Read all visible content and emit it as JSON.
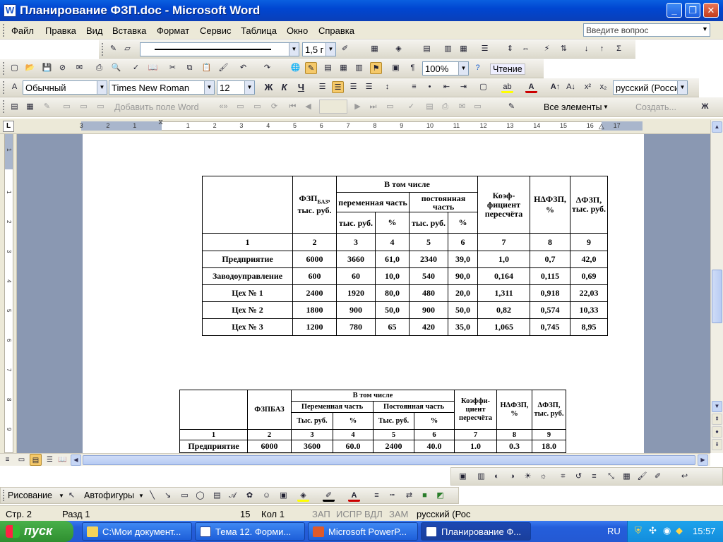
{
  "window": {
    "title": "Планирование ФЗП.doc - Microsoft Word",
    "word_icon": "W"
  },
  "menu": {
    "items": [
      "Файл",
      "Правка",
      "Вид",
      "Вставка",
      "Формат",
      "Сервис",
      "Таблица",
      "Окно",
      "Справка"
    ],
    "ask_placeholder": "Введите вопрос"
  },
  "toolbar_line": {
    "width_value": "1,5 г"
  },
  "toolbar_standard": {
    "zoom": "100%",
    "reading": "Чтение"
  },
  "toolbar_format": {
    "style": "Обычный",
    "font": "Times New Roman",
    "size": "12",
    "bold": "Ж",
    "italic": "К",
    "underline": "Ч",
    "language": "русский (Росси."
  },
  "toolbar_mailmerge": {
    "add_field": "Добавить поле Word",
    "all_elements": "Все элементы",
    "create": "Создать...",
    "bold_small": "Ж"
  },
  "ruler": {
    "numbers": [
      "3",
      "2",
      "1",
      "1",
      "2",
      "3",
      "4",
      "5",
      "6",
      "7",
      "8",
      "9",
      "10",
      "11",
      "12",
      "13",
      "14",
      "15",
      "16",
      "17"
    ],
    "vnumbers": [
      "1",
      "1",
      "2",
      "3",
      "4",
      "5",
      "6",
      "7",
      "8",
      "9",
      "10"
    ]
  },
  "table1": {
    "h_fzp": "ФЗП",
    "h_fzp_sub": "БАЗ",
    "h_fzp_unit": ", тыс. руб.",
    "h_incl": "В том числе",
    "h_var": "переменная часть",
    "h_const": "постоянная часть",
    "h_k": "Коэф-фициент пересчёта",
    "h_n": "НΔФЗП, %",
    "h_d": "ΔФЗП, тыс. руб.",
    "h_tr": "тыс. руб.",
    "h_pct": "%",
    "nums": [
      "1",
      "2",
      "3",
      "4",
      "5",
      "6",
      "7",
      "8",
      "9"
    ],
    "rows": [
      [
        "Предприятие",
        "6000",
        "3660",
        "61,0",
        "2340",
        "39,0",
        "1,0",
        "0,7",
        "42,0"
      ],
      [
        "Заводоуправление",
        "600",
        "60",
        "10,0",
        "540",
        "90,0",
        "0,164",
        "0,115",
        "0,69"
      ],
      [
        "Цех № 1",
        "2400",
        "1920",
        "80,0",
        "480",
        "20,0",
        "1,311",
        "0,918",
        "22,03"
      ],
      [
        "Цех № 2",
        "1800",
        "900",
        "50,0",
        "900",
        "50,0",
        "0,82",
        "0,574",
        "10,33"
      ],
      [
        "Цех № 3",
        "1200",
        "780",
        "65",
        "420",
        "35,0",
        "1,065",
        "0,745",
        "8,95"
      ]
    ]
  },
  "table2": {
    "h_fzp": "ФЗПБАЗ",
    "h_incl": "В том числе",
    "h_var": "Переменная часть",
    "h_const": "Постоянная часть",
    "h_k": "Коэффи-циент пересчёта",
    "h_n": "НΔФЗП, %",
    "h_d": "ΔФЗП, тыс. руб.",
    "h_tr": "Тыс. руб.",
    "h_pct": "%",
    "nums": [
      "1",
      "2",
      "3",
      "4",
      "5",
      "6",
      "7",
      "8",
      "9"
    ],
    "row": [
      "Предприятие",
      "6000",
      "3600",
      "60.0",
      "2400",
      "40.0",
      "1.0",
      "0.3",
      "18.0"
    ]
  },
  "toolbar_draw": {
    "draw": "Рисование",
    "autoshapes": "Автофигуры"
  },
  "status": {
    "page": "Стр. 2",
    "section": "Разд 1",
    "line_num": "15",
    "col": "Кол 1",
    "rec": "ЗАП",
    "trk": "ИСПР",
    "ext": "ВДЛ",
    "ovr": "ЗАМ",
    "lang": "русский (Рос"
  },
  "taskbar": {
    "start": "пуск",
    "tasks": [
      "C:\\Мои документ...",
      "Тема 12. Форми...",
      "Microsoft PowerP...",
      "Планирование Ф..."
    ],
    "lang": "RU",
    "time": "15:57"
  },
  "colors": {
    "title": "#0046d1",
    "taskbar": "#245edb",
    "start": "#2f8f30",
    "page_bg": "#8a98b2"
  }
}
